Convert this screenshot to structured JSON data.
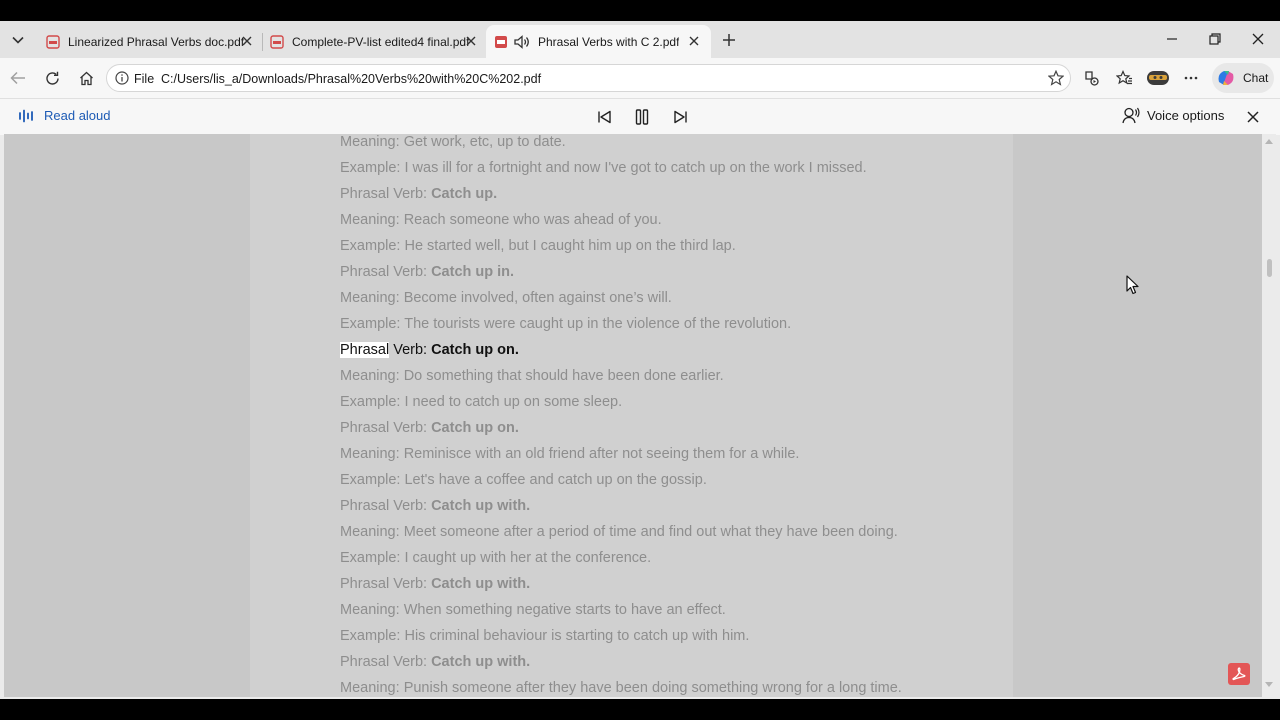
{
  "tabs": [
    {
      "label": "Linearized Phrasal Verbs doc.pdf",
      "active": false
    },
    {
      "label": "Complete-PV-list edited4 final.pdf",
      "active": false
    },
    {
      "label": "Phrasal Verbs with C 2.pdf",
      "active": true
    }
  ],
  "address": {
    "scheme_label": "File",
    "url": "C:/Users/lis_a/Downloads/Phrasal%20Verbs%20with%20C%202.pdf"
  },
  "toolbar": {
    "chat_label": "Chat"
  },
  "read_aloud": {
    "label": "Read aloud",
    "voice_options_label": "Voice options"
  },
  "document": {
    "lines": [
      {
        "prefix": "Meaning: ",
        "text": "Get work, etc, up to date.",
        "bold": false
      },
      {
        "prefix": "Example: ",
        "text": "I was ill for a fortnight and now I've got to catch up on the work I missed.",
        "bold": false
      },
      {
        "prefix": "Phrasal Verb: ",
        "text": "Catch up.",
        "bold": true
      },
      {
        "prefix": "Meaning: ",
        "text": "Reach someone who was ahead of you.",
        "bold": false
      },
      {
        "prefix": "Example: ",
        "text": "He started well, but I caught him up on the third lap.",
        "bold": false
      },
      {
        "prefix": "Phrasal Verb: ",
        "text": "Catch up in.",
        "bold": true
      },
      {
        "prefix": "Meaning: ",
        "text": "Become involved, often against one’s will.",
        "bold": false
      },
      {
        "prefix": "Example: ",
        "text": "The tourists were caught up in the violence of the revolution.",
        "bold": false
      },
      {
        "prefix": "Phrasal Verb: ",
        "text": "Catch up on.",
        "bold": true,
        "current": true,
        "highlight_word": "Phrasal"
      },
      {
        "prefix": "Meaning: ",
        "text": "Do something that should have been done earlier.",
        "bold": false
      },
      {
        "prefix": "Example: ",
        "text": "I need to catch up on some sleep.",
        "bold": false
      },
      {
        "prefix": "Phrasal Verb: ",
        "text": "Catch up on.",
        "bold": true
      },
      {
        "prefix": "Meaning: ",
        "text": "Reminisce with an old friend after not seeing them for a while.",
        "bold": false
      },
      {
        "prefix": "Example: ",
        "text": "Let's have a coffee and catch up on the gossip.",
        "bold": false
      },
      {
        "prefix": "Phrasal Verb: ",
        "text": "Catch up with.",
        "bold": true
      },
      {
        "prefix": "Meaning: ",
        "text": "Meet someone after a period of time and find out what they have been doing.",
        "bold": false
      },
      {
        "prefix": "Example: ",
        "text": "I caught up with her at the conference.",
        "bold": false
      },
      {
        "prefix": "Phrasal Verb: ",
        "text": "Catch up with.",
        "bold": true
      },
      {
        "prefix": "Meaning: ",
        "text": "When something negative starts to have an effect.",
        "bold": false
      },
      {
        "prefix": "Example: ",
        "text": "His criminal behaviour is starting to catch up with him.",
        "bold": false
      },
      {
        "prefix": "Phrasal Verb: ",
        "text": "Catch up with.",
        "bold": true
      },
      {
        "prefix": "Meaning: ",
        "text": "Punish someone after they have been doing something wrong for a long time.",
        "bold": false
      }
    ]
  },
  "colors": {
    "accent": "#1d5bb5",
    "dim_text": "#8e8e8e",
    "current_text": "#111111",
    "pdf_red": "#e35656"
  }
}
